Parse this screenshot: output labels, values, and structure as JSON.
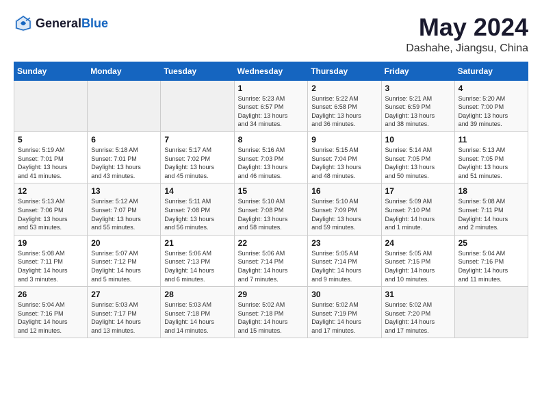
{
  "header": {
    "logo": {
      "general": "General",
      "blue": "Blue"
    },
    "title": "May 2024",
    "location": "Dashahe, Jiangsu, China"
  },
  "calendar": {
    "weekdays": [
      "Sunday",
      "Monday",
      "Tuesday",
      "Wednesday",
      "Thursday",
      "Friday",
      "Saturday"
    ],
    "weeks": [
      [
        {
          "day": "",
          "info": ""
        },
        {
          "day": "",
          "info": ""
        },
        {
          "day": "",
          "info": ""
        },
        {
          "day": "1",
          "info": "Sunrise: 5:23 AM\nSunset: 6:57 PM\nDaylight: 13 hours\nand 34 minutes."
        },
        {
          "day": "2",
          "info": "Sunrise: 5:22 AM\nSunset: 6:58 PM\nDaylight: 13 hours\nand 36 minutes."
        },
        {
          "day": "3",
          "info": "Sunrise: 5:21 AM\nSunset: 6:59 PM\nDaylight: 13 hours\nand 38 minutes."
        },
        {
          "day": "4",
          "info": "Sunrise: 5:20 AM\nSunset: 7:00 PM\nDaylight: 13 hours\nand 39 minutes."
        }
      ],
      [
        {
          "day": "5",
          "info": "Sunrise: 5:19 AM\nSunset: 7:01 PM\nDaylight: 13 hours\nand 41 minutes."
        },
        {
          "day": "6",
          "info": "Sunrise: 5:18 AM\nSunset: 7:01 PM\nDaylight: 13 hours\nand 43 minutes."
        },
        {
          "day": "7",
          "info": "Sunrise: 5:17 AM\nSunset: 7:02 PM\nDaylight: 13 hours\nand 45 minutes."
        },
        {
          "day": "8",
          "info": "Sunrise: 5:16 AM\nSunset: 7:03 PM\nDaylight: 13 hours\nand 46 minutes."
        },
        {
          "day": "9",
          "info": "Sunrise: 5:15 AM\nSunset: 7:04 PM\nDaylight: 13 hours\nand 48 minutes."
        },
        {
          "day": "10",
          "info": "Sunrise: 5:14 AM\nSunset: 7:05 PM\nDaylight: 13 hours\nand 50 minutes."
        },
        {
          "day": "11",
          "info": "Sunrise: 5:13 AM\nSunset: 7:05 PM\nDaylight: 13 hours\nand 51 minutes."
        }
      ],
      [
        {
          "day": "12",
          "info": "Sunrise: 5:13 AM\nSunset: 7:06 PM\nDaylight: 13 hours\nand 53 minutes."
        },
        {
          "day": "13",
          "info": "Sunrise: 5:12 AM\nSunset: 7:07 PM\nDaylight: 13 hours\nand 55 minutes."
        },
        {
          "day": "14",
          "info": "Sunrise: 5:11 AM\nSunset: 7:08 PM\nDaylight: 13 hours\nand 56 minutes."
        },
        {
          "day": "15",
          "info": "Sunrise: 5:10 AM\nSunset: 7:08 PM\nDaylight: 13 hours\nand 58 minutes."
        },
        {
          "day": "16",
          "info": "Sunrise: 5:10 AM\nSunset: 7:09 PM\nDaylight: 13 hours\nand 59 minutes."
        },
        {
          "day": "17",
          "info": "Sunrise: 5:09 AM\nSunset: 7:10 PM\nDaylight: 14 hours\nand 1 minute."
        },
        {
          "day": "18",
          "info": "Sunrise: 5:08 AM\nSunset: 7:11 PM\nDaylight: 14 hours\nand 2 minutes."
        }
      ],
      [
        {
          "day": "19",
          "info": "Sunrise: 5:08 AM\nSunset: 7:11 PM\nDaylight: 14 hours\nand 3 minutes."
        },
        {
          "day": "20",
          "info": "Sunrise: 5:07 AM\nSunset: 7:12 PM\nDaylight: 14 hours\nand 5 minutes."
        },
        {
          "day": "21",
          "info": "Sunrise: 5:06 AM\nSunset: 7:13 PM\nDaylight: 14 hours\nand 6 minutes."
        },
        {
          "day": "22",
          "info": "Sunrise: 5:06 AM\nSunset: 7:14 PM\nDaylight: 14 hours\nand 7 minutes."
        },
        {
          "day": "23",
          "info": "Sunrise: 5:05 AM\nSunset: 7:14 PM\nDaylight: 14 hours\nand 9 minutes."
        },
        {
          "day": "24",
          "info": "Sunrise: 5:05 AM\nSunset: 7:15 PM\nDaylight: 14 hours\nand 10 minutes."
        },
        {
          "day": "25",
          "info": "Sunrise: 5:04 AM\nSunset: 7:16 PM\nDaylight: 14 hours\nand 11 minutes."
        }
      ],
      [
        {
          "day": "26",
          "info": "Sunrise: 5:04 AM\nSunset: 7:16 PM\nDaylight: 14 hours\nand 12 minutes."
        },
        {
          "day": "27",
          "info": "Sunrise: 5:03 AM\nSunset: 7:17 PM\nDaylight: 14 hours\nand 13 minutes."
        },
        {
          "day": "28",
          "info": "Sunrise: 5:03 AM\nSunset: 7:18 PM\nDaylight: 14 hours\nand 14 minutes."
        },
        {
          "day": "29",
          "info": "Sunrise: 5:02 AM\nSunset: 7:18 PM\nDaylight: 14 hours\nand 15 minutes."
        },
        {
          "day": "30",
          "info": "Sunrise: 5:02 AM\nSunset: 7:19 PM\nDaylight: 14 hours\nand 17 minutes."
        },
        {
          "day": "31",
          "info": "Sunrise: 5:02 AM\nSunset: 7:20 PM\nDaylight: 14 hours\nand 17 minutes."
        },
        {
          "day": "",
          "info": ""
        }
      ]
    ]
  }
}
